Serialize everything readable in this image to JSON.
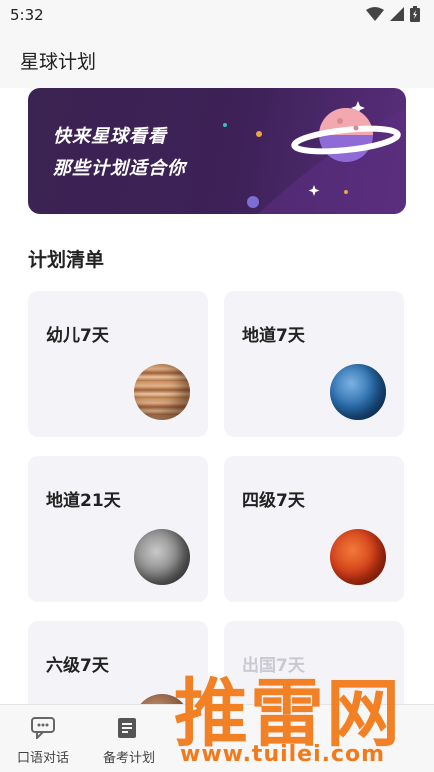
{
  "status_bar": {
    "time": "5:32"
  },
  "app_bar": {
    "title": "星球计划"
  },
  "banner": {
    "line1": "快来星球看看",
    "line2": "那些计划适合你"
  },
  "section": {
    "title": "计划清单"
  },
  "plans": [
    {
      "label": "幼儿7天",
      "planet": "jupiter"
    },
    {
      "label": "地道7天",
      "planet": "earth"
    },
    {
      "label": "地道21天",
      "planet": "mercury"
    },
    {
      "label": "四级7天",
      "planet": "mars"
    },
    {
      "label": "六级7天",
      "planet": "venus"
    },
    {
      "label": "出国7天",
      "planet": ""
    }
  ],
  "tabs": [
    {
      "label": "口语对话",
      "icon": "chat-icon"
    },
    {
      "label": "备考计划",
      "icon": "document-icon"
    }
  ],
  "watermark": {
    "title": "推雷网",
    "url": "www.tuilei.com"
  },
  "colors": {
    "banner": "#3d2157",
    "card": "#f4f3f7",
    "accent": "#f27a1a"
  }
}
